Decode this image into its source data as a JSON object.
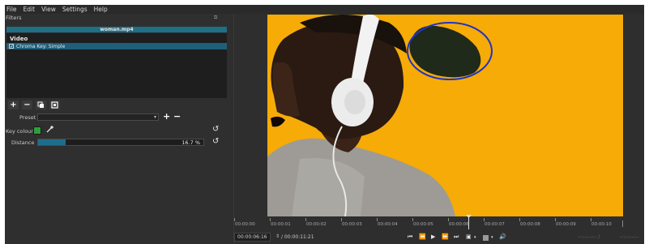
{
  "menu": [
    "File",
    "Edit",
    "View",
    "Settings",
    "Help"
  ],
  "filters_panel": {
    "title": "Filters",
    "float_icon": "⧉",
    "clip_name": "woman.mp4",
    "section": "Video",
    "filters": [
      {
        "name": "Chroma Key: Simple",
        "checked": true
      }
    ],
    "toolbar": [
      "add-icon",
      "remove-icon",
      "copy-icon",
      "deselect-icon"
    ],
    "preset": {
      "label": "Preset",
      "value": ""
    },
    "key_colour": {
      "label": "Key colour",
      "color": "#2e9e3c"
    },
    "distance": {
      "label": "Distance",
      "value_text": "16.7 %",
      "percent": 16.7
    }
  },
  "preview": {
    "background_color": "#f6ab07",
    "annotation_color": "#1e34c8"
  },
  "timeline": {
    "ticks": [
      "00:00:00",
      "00:00:01",
      "00:00:02",
      "00:00:03",
      "00:00:04",
      "00:00:05",
      "00:00:06",
      "00:00:07",
      "00:00:08",
      "00:00:09",
      "00:00:10"
    ]
  },
  "transport": {
    "position": "00:00:06:16",
    "duration": "/ 00:00:11:21",
    "in_point": "--:--:--:-- /",
    "out_point": "--:--:--:--"
  }
}
